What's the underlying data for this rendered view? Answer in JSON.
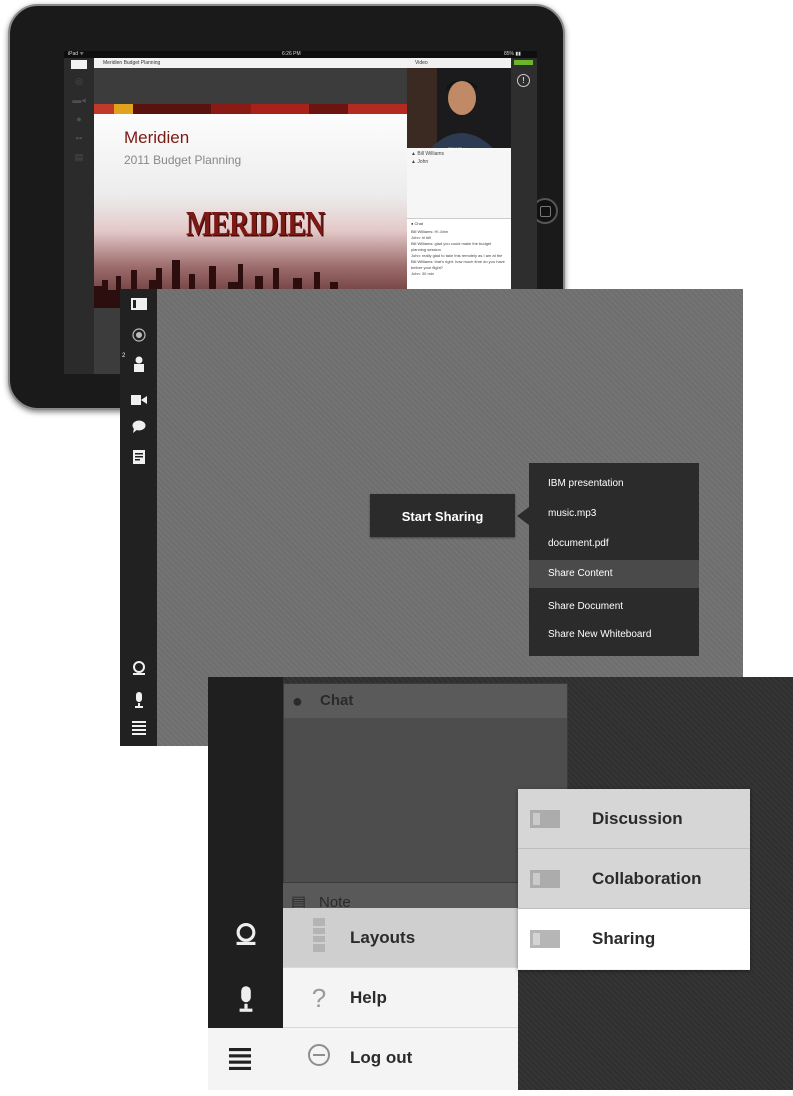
{
  "ipad": {
    "status": {
      "left": "iPad ᯤ",
      "time": "6:26 PM",
      "right": "85% ▮▮"
    },
    "meeting_title": "Meridien Budget Planning",
    "slide": {
      "title": "Meridien",
      "subtitle": "2011 Budget Planning",
      "logo": "MERIDIEN"
    },
    "video_label": "Video",
    "video_caption": "Bill Williams",
    "attendees": [
      "Bill Williams",
      "John"
    ],
    "chat_label": "Chat",
    "chat_lines": [
      "Bill Williams: Hi John",
      "John: hi bill",
      "Bill Williams: glad you could make the budget planning session",
      "John: really glad to take this remotely as I am at the",
      "Bill Williams: that's right. how much time do you have before your flight?",
      "John: 30 min"
    ]
  },
  "sharing": {
    "start_button": "Start Sharing",
    "attendee_count": "2",
    "menu": [
      {
        "label": "IBM presentation"
      },
      {
        "label": "music.mp3"
      },
      {
        "label": "document.pdf"
      },
      {
        "label": "Share Content"
      },
      {
        "label": "Share Document"
      },
      {
        "label": "Share New Whiteboard"
      }
    ]
  },
  "layouts": {
    "chat_title": "Chat",
    "note_title": "Note",
    "main_menu": [
      {
        "label": "Layouts",
        "icon": "layouts-icon"
      },
      {
        "label": "Help",
        "icon": "help-icon"
      },
      {
        "label": "Log out",
        "icon": "logout-icon"
      }
    ],
    "submenu": [
      {
        "label": "Discussion"
      },
      {
        "label": "Collaboration"
      },
      {
        "label": "Sharing"
      }
    ]
  },
  "colors": {
    "accent_green": "#6bb52a",
    "brand_red": "#7c1915",
    "dark_panel": "#2b2b2b"
  }
}
